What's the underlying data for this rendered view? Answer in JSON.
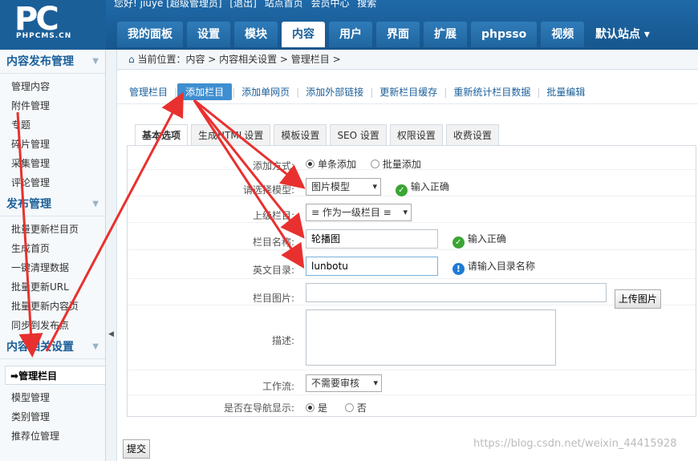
{
  "header": {
    "logo_text": "PC",
    "logo_sub": "PHPCMS.CN",
    "user_items": [
      "您好! jiuye [超级管理员]",
      "[退出]",
      "站点首页",
      "会员中心",
      "搜索"
    ],
    "nav": [
      "我的面板",
      "设置",
      "模块",
      "内容",
      "用户",
      "界面",
      "扩展",
      "phpsso",
      "视频"
    ],
    "active_nav": "内容",
    "site": "默认站点 ▾"
  },
  "sidebar": {
    "sections": [
      {
        "title": "内容发布管理",
        "items": [
          "管理内容",
          "附件管理",
          "专题",
          "碎片管理",
          "采集管理",
          "评论管理"
        ]
      },
      {
        "title": "发布管理",
        "items": [
          "批量更新栏目页",
          "生成首页",
          "一键清理数据",
          "批量更新URL",
          "批量更新内容页",
          "同步到发布点"
        ]
      },
      {
        "title": "内容相关设置",
        "items": [
          "管理栏目",
          "模型管理",
          "类别管理",
          "推荐位管理"
        ]
      }
    ],
    "current": "管理栏目"
  },
  "breadcrumb": "当前位置：内容 > 内容相关设置 > 管理栏目 >",
  "subnav": [
    "管理栏目",
    "添加栏目",
    "添加单网页",
    "添加外部链接",
    "更新栏目缓存",
    "重新统计栏目数据",
    "批量编辑"
  ],
  "subnav_active": "添加栏目",
  "tabs": [
    "基本选项",
    "生成HTML设置",
    "模板设置",
    "SEO 设置",
    "权限设置",
    "收费设置"
  ],
  "form": {
    "add_method": {
      "label": "添加方式:",
      "opt1": "单条添加",
      "opt2": "批量添加"
    },
    "model": {
      "label": "请选择模型:",
      "value": "图片模型",
      "msg": "输入正确"
    },
    "parent": {
      "label": "上级栏目:",
      "value": "≡ 作为一级栏目 ≡"
    },
    "name": {
      "label": "栏目名称:",
      "value": "轮播图",
      "msg": "输入正确"
    },
    "dir": {
      "label": "英文目录:",
      "value": "lunbotu",
      "msg": "请输入目录名称"
    },
    "image": {
      "label": "栏目图片:",
      "button": "上传图片"
    },
    "desc": {
      "label": "描述:"
    },
    "workflow": {
      "label": "工作流:",
      "value": "不需要审核"
    },
    "navshow": {
      "label": "是否在导航显示:",
      "opt1": "是",
      "opt2": "否"
    }
  },
  "submit": "提交",
  "watermark": "https://blog.csdn.net/weixin_44415928",
  "icons": {
    "home": "home-icon",
    "ok": "check-circle-icon",
    "info": "info-circle-icon"
  }
}
